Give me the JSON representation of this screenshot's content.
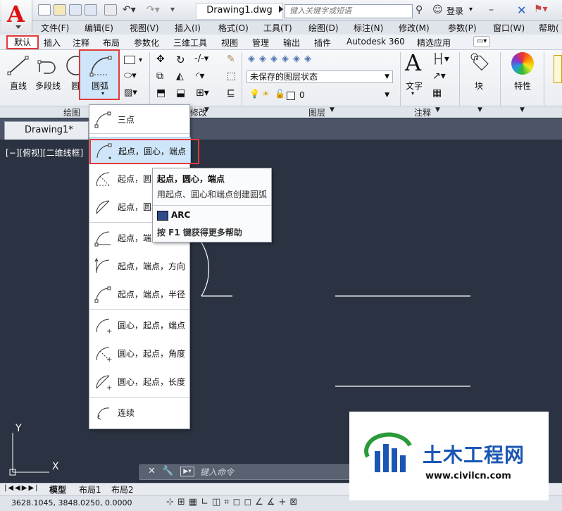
{
  "titlebar": {
    "doc_title": "Drawing1.dwg",
    "search_placeholder": "键入关键字或短语",
    "login": "登录"
  },
  "menu": [
    "文件(F)",
    "编辑(E)",
    "视图(V)",
    "插入(I)",
    "格式(O)",
    "工具(T)",
    "绘图(D)",
    "标注(N)",
    "修改(M)",
    "参数(P)",
    "窗口(W)",
    "帮助("
  ],
  "tabs": [
    "默认",
    "插入",
    "注释",
    "布局",
    "参数化",
    "三维工具",
    "视图",
    "管理",
    "输出",
    "插件",
    "Autodesk 360",
    "精选应用"
  ],
  "ribbon": {
    "line": "直线",
    "polyline": "多段线",
    "circle": "圆",
    "arc": "圆弧",
    "layer_state": "未保存的图层状态",
    "layer_value": "0",
    "text": "文字",
    "block": "块",
    "properties": "特性",
    "panels": {
      "draw": "绘图",
      "modify": "修改",
      "layer": "图层",
      "annotation": "注释"
    }
  },
  "doc_tab": "Drawing1*",
  "viewport_label": "[−][俯视][二维线框]",
  "arc_menu": [
    {
      "label": "三点",
      "icon": "arc-3point-icon"
    },
    {
      "label": "起点，圆心，端点",
      "icon": "arc-start-center-end-icon"
    },
    {
      "label": "起点，圆心，角度",
      "icon": "arc-start-center-angle-icon"
    },
    {
      "label": "起点，圆心，长度",
      "icon": "arc-start-center-length-icon"
    },
    {
      "label": "起点，端点，角度",
      "icon": "arc-start-end-angle-icon"
    },
    {
      "label": "起点，端点，方向",
      "icon": "arc-start-end-direction-icon"
    },
    {
      "label": "起点，端点，半径",
      "icon": "arc-start-end-radius-icon"
    },
    {
      "label": "圆心，起点，端点",
      "icon": "arc-center-start-end-icon"
    },
    {
      "label": "圆心，起点，角度",
      "icon": "arc-center-start-angle-icon"
    },
    {
      "label": "圆心，起点，长度",
      "icon": "arc-center-start-length-icon"
    },
    {
      "label": "连续",
      "icon": "arc-continue-icon"
    }
  ],
  "tooltip": {
    "title": "起点，圆心，端点",
    "desc": "用起点、圆心和端点创建圆弧",
    "command": "ARC",
    "help": "按 F1 键获得更多帮助"
  },
  "command": {
    "placeholder": "键入命令"
  },
  "layout_tabs": [
    "模型",
    "布局1",
    "布局2"
  ],
  "status": {
    "coords": "3628.1045, 3848.0250, 0.0000"
  },
  "ucs": {
    "x": "X",
    "y": "Y"
  },
  "watermark": {
    "brand": "土木工程网",
    "url": "www.civilcn.com"
  },
  "colors": {
    "highlight": "#e23a3a",
    "canvas": "#2b3342",
    "selected": "#cfe6fa",
    "brand_blue": "#1b56b3"
  }
}
